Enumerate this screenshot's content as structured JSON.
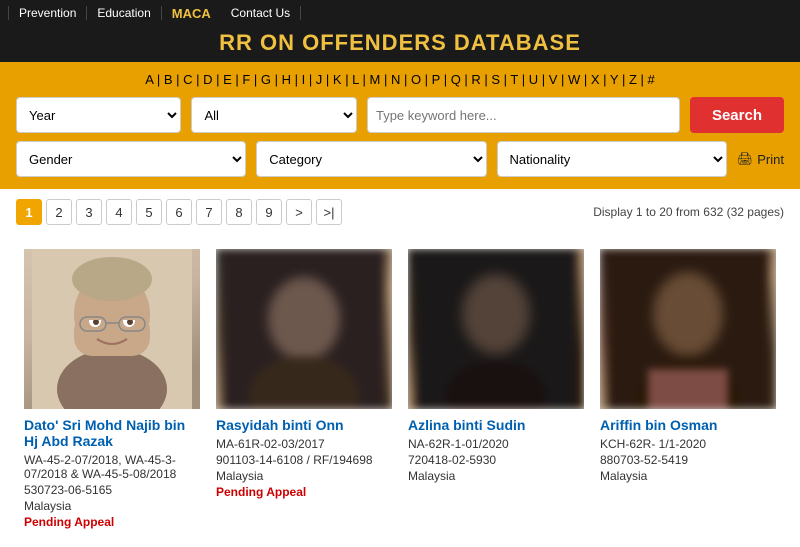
{
  "nav": {
    "items": [
      {
        "label": "Prevention",
        "href": "#"
      },
      {
        "label": "Education",
        "href": "#"
      },
      {
        "label": "MACA",
        "href": "#"
      },
      {
        "label": "Contact Us",
        "href": "#"
      }
    ],
    "brand": "MACA"
  },
  "header": {
    "title": "RR ON OFFENDERS DATABASE"
  },
  "alphabet": {
    "letters": [
      "A",
      "B",
      "C",
      "D",
      "E",
      "F",
      "G",
      "H",
      "I",
      "J",
      "K",
      "L",
      "M",
      "N",
      "O",
      "P",
      "Q",
      "R",
      "S",
      "T",
      "U",
      "V",
      "W",
      "X",
      "Y",
      "Z",
      "#"
    ]
  },
  "search": {
    "year_placeholder": "Year",
    "type_placeholder": "All",
    "keyword_placeholder": "Type keyword here...",
    "search_label": "Search",
    "gender_placeholder": "Gender",
    "category_placeholder": "Category",
    "nationality_placeholder": "Nationality",
    "print_label": "Print"
  },
  "pagination": {
    "pages": [
      "1",
      "2",
      "3",
      "4",
      "5",
      "6",
      "7",
      "8",
      "9",
      ">",
      ">|"
    ],
    "active": "1",
    "display_info": "Display 1 to 20 from 632 (32 pages)"
  },
  "cards": [
    {
      "name": "Dato' Sri Mohd Najib bin Hj Abd Razak",
      "ids": "WA-45-2-07/2018, WA-45-3-07/2018 & WA-45-5-08/2018",
      "case_id": "530723-06-5165",
      "country": "Malaysia",
      "status": "Pending Appeal",
      "img_class": "person1"
    },
    {
      "name": "Rasyidah binti Onn",
      "ids": "MA-61R-02-03/2017",
      "case_id": "901103-14-6108 / RF/194698",
      "country": "Malaysia",
      "status": "Pending Appeal",
      "img_class": "person2"
    },
    {
      "name": "Azlina binti Sudin",
      "ids": "NA-62R-1-01/2020",
      "case_id": "720418-02-5930",
      "country": "Malaysia",
      "status": "",
      "img_class": "person3"
    },
    {
      "name": "Ariffin bin Osman",
      "ids": "KCH-62R- 1/1-2020",
      "case_id": "880703-52-5419",
      "country": "Malaysia",
      "status": "",
      "img_class": "person4"
    }
  ]
}
